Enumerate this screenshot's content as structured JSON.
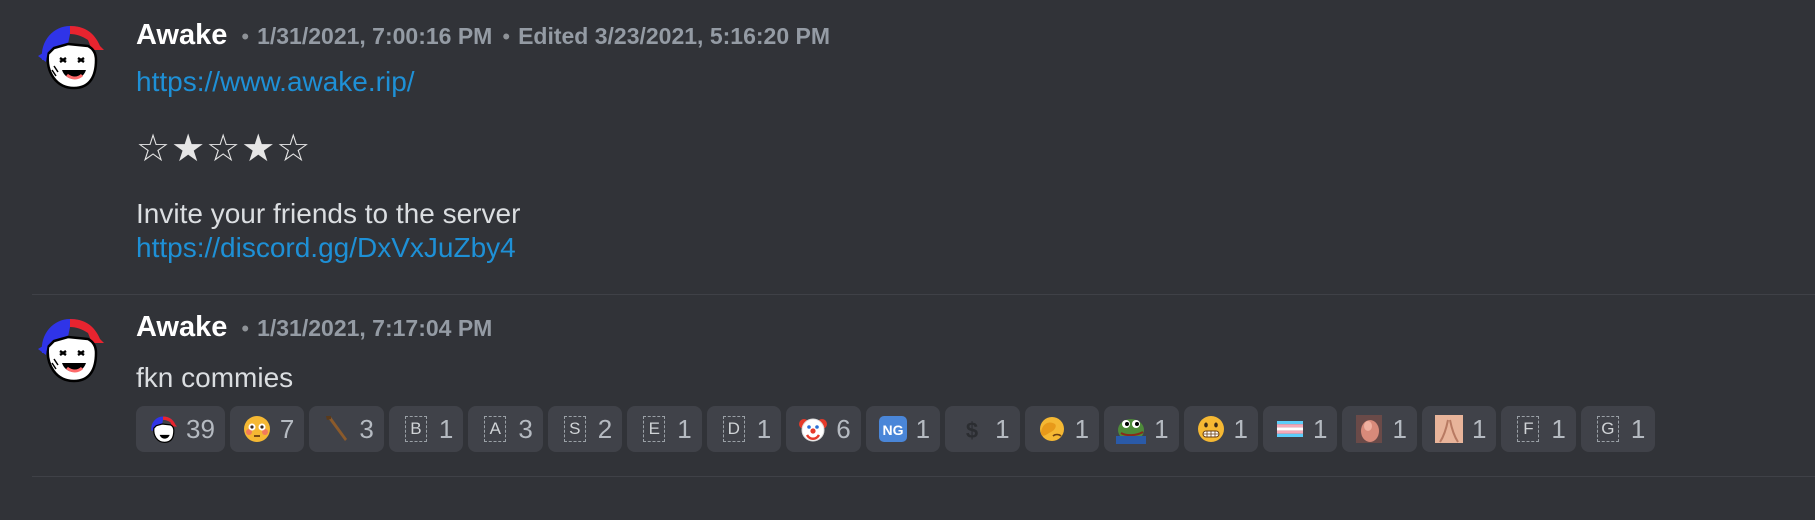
{
  "messages": [
    {
      "username": "Awake",
      "timestamp": "1/31/2021, 7:00:16 PM",
      "edited": "Edited 3/23/2021, 5:16:20 PM",
      "link1": "https://www.awake.rip/",
      "stars": "☆★☆★☆",
      "invite_text": "Invite your friends to the server",
      "link2": "https://discord.gg/DxVxJuZby4"
    },
    {
      "username": "Awake",
      "timestamp": "1/31/2021, 7:17:04 PM",
      "text": "fkn commies"
    }
  ],
  "separator": "•",
  "reactions": [
    {
      "icon": "awake-avatar-icon",
      "count": "39"
    },
    {
      "icon": "flushed-face-icon",
      "count": "7"
    },
    {
      "icon": "baseball-bat-icon",
      "count": "3"
    },
    {
      "icon": "letter-b-icon",
      "letter": "B",
      "count": "1"
    },
    {
      "icon": "letter-a-icon",
      "letter": "A",
      "count": "3"
    },
    {
      "icon": "letter-s-icon",
      "letter": "S",
      "count": "2"
    },
    {
      "icon": "letter-e-icon",
      "letter": "E",
      "count": "1"
    },
    {
      "icon": "letter-d-icon",
      "letter": "D",
      "count": "1"
    },
    {
      "icon": "clown-face-icon",
      "count": "6"
    },
    {
      "icon": "ng-button-icon",
      "label": "NG",
      "count": "1"
    },
    {
      "icon": "heavy-dollar-icon",
      "count": "1"
    },
    {
      "icon": "facepalm-icon",
      "count": "1"
    },
    {
      "icon": "pepe-frog-icon",
      "count": "1"
    },
    {
      "icon": "grimacing-face-icon",
      "count": "1"
    },
    {
      "icon": "transgender-flag-icon",
      "count": "1"
    },
    {
      "icon": "custom-photo-icon",
      "count": "1"
    },
    {
      "icon": "custom-photo-2-icon",
      "count": "1"
    },
    {
      "icon": "letter-f-icon",
      "letter": "F",
      "count": "1"
    },
    {
      "icon": "letter-g-icon",
      "letter": "G",
      "count": "1"
    }
  ],
  "colors": {
    "background": "#313338",
    "link": "#1e90d6",
    "reaction_bg": "#404249"
  }
}
